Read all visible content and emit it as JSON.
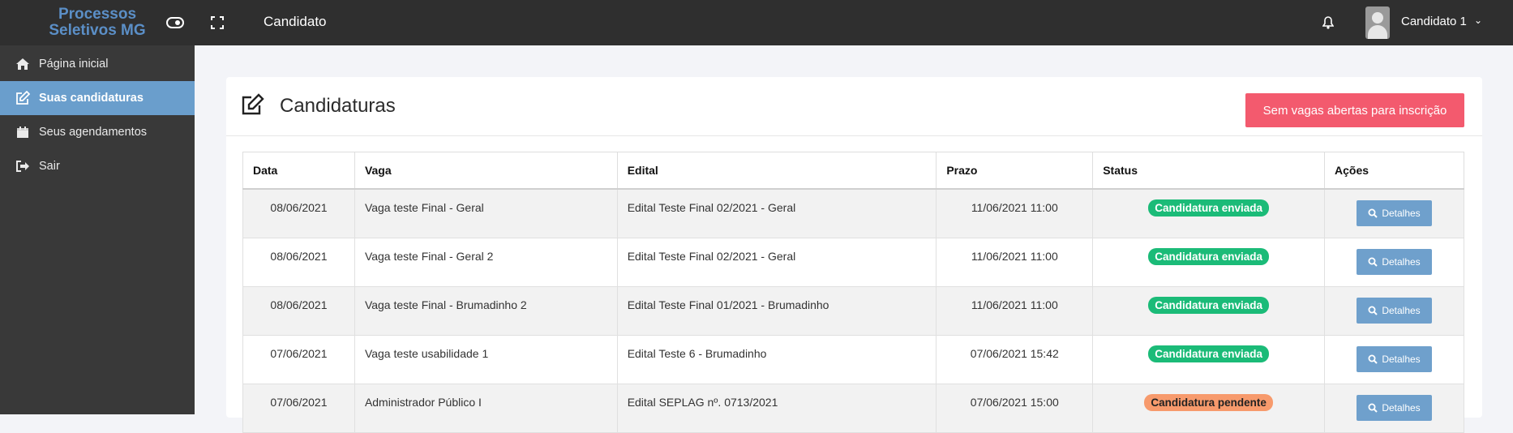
{
  "brand": {
    "line1": "Processos",
    "line2": "Seletivos MG"
  },
  "header": {
    "title": "Candidato",
    "user": "Candidato 1"
  },
  "sidebar": {
    "items": [
      {
        "label": "Página inicial",
        "icon": "home-icon"
      },
      {
        "label": "Suas candidaturas",
        "icon": "edit-icon",
        "active": true
      },
      {
        "label": "Seus agendamentos",
        "icon": "calendar-icon"
      },
      {
        "label": "Sair",
        "icon": "sign-out-icon"
      }
    ]
  },
  "main": {
    "title": "Candidaturas",
    "no_vacancy_label": "Sem vagas abertas para inscrição",
    "columns": [
      "Data",
      "Vaga",
      "Edital",
      "Prazo",
      "Status",
      "Ações"
    ],
    "details_label": "Detalhes",
    "rows": [
      {
        "data": "08/06/2021",
        "vaga": "Vaga teste Final - Geral",
        "edital": "Edital Teste Final 02/2021 - Geral",
        "prazo": "11/06/2021 11:00",
        "status": "Candidatura enviada",
        "status_color": "#1bbb78"
      },
      {
        "data": "08/06/2021",
        "vaga": "Vaga teste Final - Geral 2",
        "edital": "Edital Teste Final 02/2021 - Geral",
        "prazo": "11/06/2021 11:00",
        "status": "Candidatura enviada",
        "status_color": "#1bbb78"
      },
      {
        "data": "08/06/2021",
        "vaga": "Vaga teste Final - Brumadinho 2",
        "edital": "Edital Teste Final 01/2021 - Brumadinho",
        "prazo": "11/06/2021 11:00",
        "status": "Candidatura enviada",
        "status_color": "#1bbb78"
      },
      {
        "data": "07/06/2021",
        "vaga": "Vaga teste usabilidade 1",
        "edital": "Edital Teste 6 - Brumadinho",
        "prazo": "07/06/2021 15:42",
        "status": "Candidatura enviada",
        "status_color": "#1bbb78"
      },
      {
        "data": "07/06/2021",
        "vaga": "Administrador Público I",
        "edital": "Edital SEPLAG nº. 0713/2021",
        "prazo": "07/06/2021 15:00",
        "status": "Candidatura pendente",
        "status_color": "#f79a6c"
      }
    ]
  },
  "colors": {
    "topbar": "#2f2f2f",
    "sidebar": "#393939",
    "active": "#6a9ecc",
    "danger": "#f35a6e",
    "success": "#1bbb78",
    "pending": "#f79a6c"
  }
}
